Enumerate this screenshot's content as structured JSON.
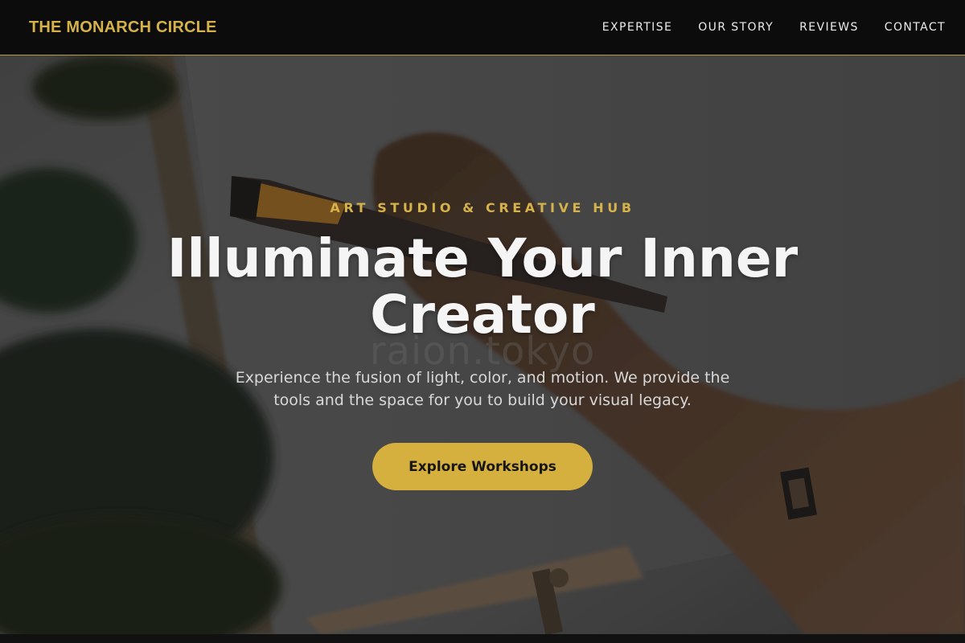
{
  "brand": {
    "name": "THE MONARCH CIRCLE",
    "color": "#d6b24a"
  },
  "nav": {
    "items": [
      {
        "label": "EXPERTISE"
      },
      {
        "label": "OUR STORY"
      },
      {
        "label": "REVIEWS"
      },
      {
        "label": "CONTACT"
      }
    ]
  },
  "hero": {
    "eyebrow": "ART STUDIO & CREATIVE HUB",
    "title": "Illuminate Your Inner Creator",
    "subtitle": "Experience the fusion of light, color, and motion. We provide the tools and the space for you to build your visual legacy.",
    "watermark": "raion.tokyo",
    "cta_label": "Explore Workshops",
    "background_image": "blurred photo of a hand painting on an easel canvas with a plant leaf in the foreground"
  },
  "colors": {
    "accent": "#d6b03e",
    "nav_bg": "#0c0c0c",
    "title": "#f5f5f5"
  }
}
